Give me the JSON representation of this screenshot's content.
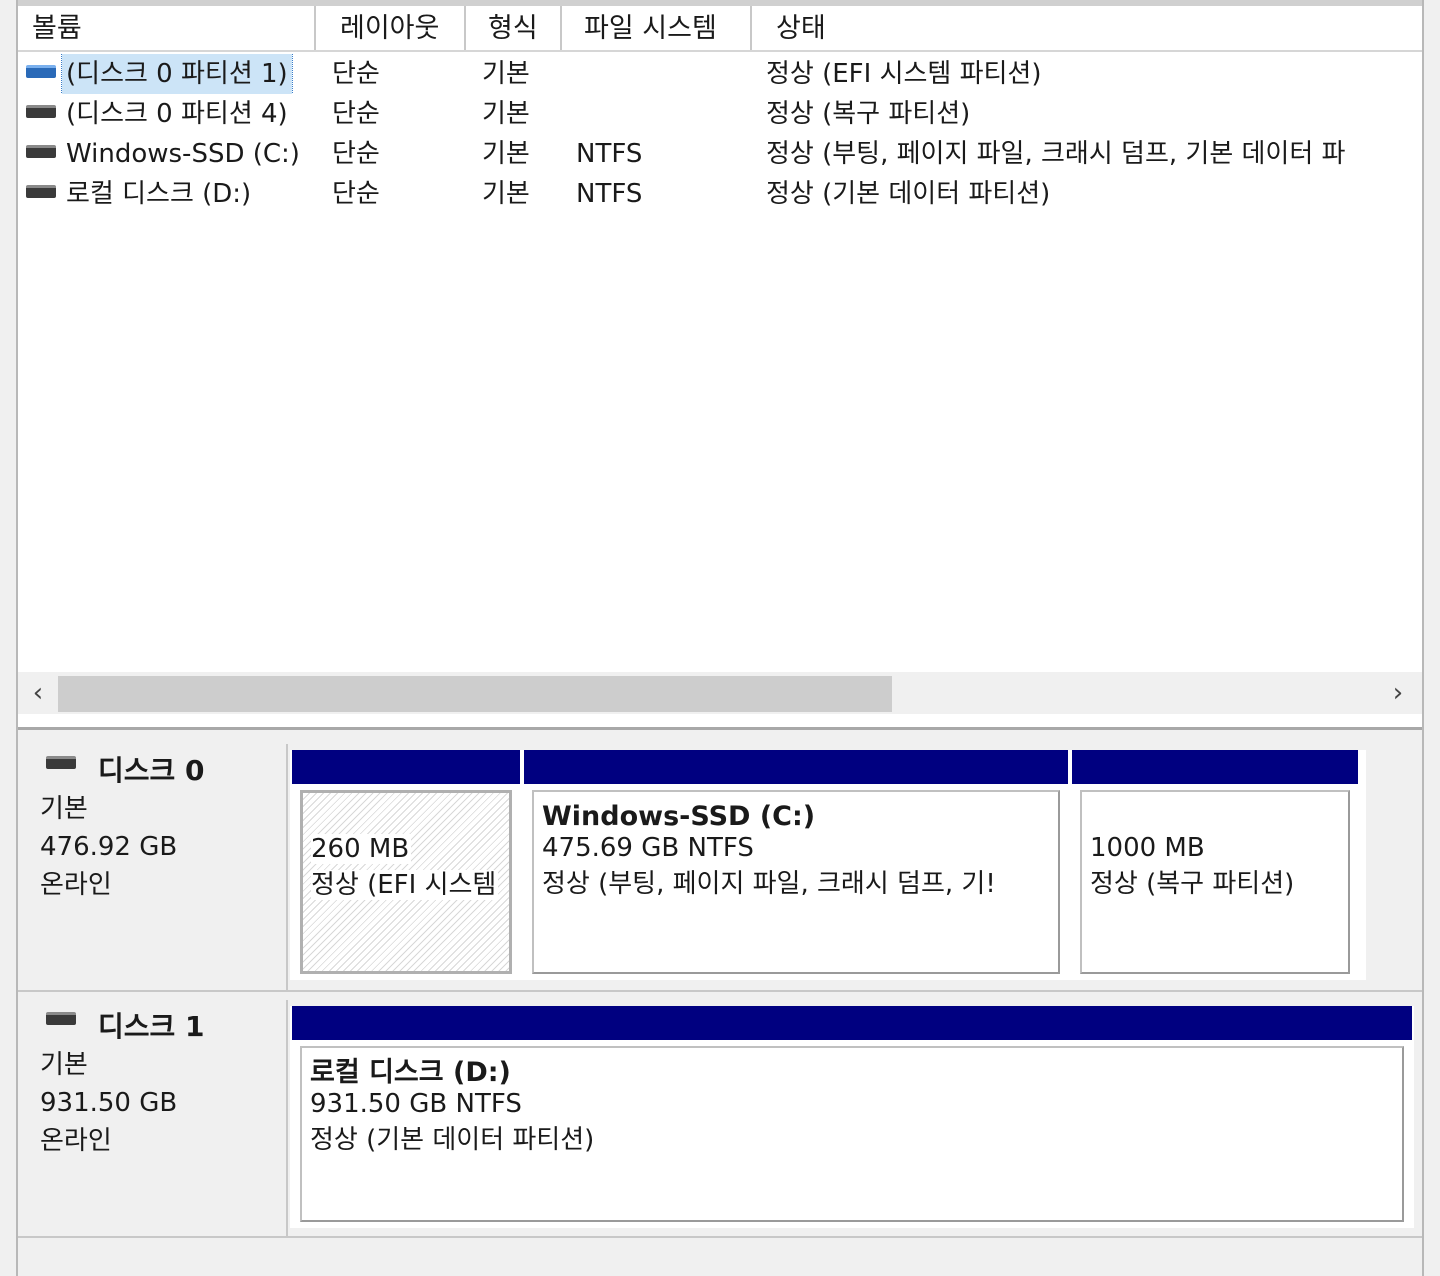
{
  "volume_list": {
    "columns": [
      "볼륨",
      "레이아웃",
      "형식",
      "파일 시스템",
      "상태"
    ],
    "rows": [
      {
        "volume": "(디스크 0 파티션 1)",
        "layout": "단순",
        "type": "기본",
        "fs": "",
        "status": "정상 (EFI 시스템 파티션)",
        "selected": true
      },
      {
        "volume": "(디스크 0 파티션 4)",
        "layout": "단순",
        "type": "기본",
        "fs": "",
        "status": "정상 (복구 파티션)"
      },
      {
        "volume": "Windows-SSD (C:)",
        "layout": "단순",
        "type": "기본",
        "fs": "NTFS",
        "status": "정상 (부팅, 페이지 파일, 크래시 덤프, 기본 데이터 파"
      },
      {
        "volume": "로컬 디스크 (D:)",
        "layout": "단순",
        "type": "기본",
        "fs": "NTFS",
        "status": "정상 (기본 데이터 파티션)"
      }
    ],
    "scroll_left": "‹",
    "scroll_right": "›"
  },
  "disks": [
    {
      "name": "디스크 0",
      "kind": "기본",
      "size": "476.92 GB",
      "state": "온라인",
      "partitions": [
        {
          "name": "",
          "size": "260 MB",
          "status": "정상 (EFI 시스템",
          "hatched": true
        },
        {
          "name": "Windows-SSD  (C:)",
          "size": "475.69 GB NTFS",
          "status": "정상 (부팅, 페이지 파일, 크래시 덤프, 기!"
        },
        {
          "name": "",
          "size": "1000 MB",
          "status": "정상 (복구 파티션)"
        }
      ]
    },
    {
      "name": "디스크 1",
      "kind": "기본",
      "size": "931.50 GB",
      "state": "온라인",
      "partitions": [
        {
          "name": "로컬 디스크  (D:)",
          "size": "931.50 GB NTFS",
          "status": "정상 (기본 데이터 파티션)"
        }
      ]
    }
  ],
  "colors": {
    "partition_bar": "#000080",
    "selection": "#cce4f7",
    "panel_bg": "#f0f0f0"
  }
}
